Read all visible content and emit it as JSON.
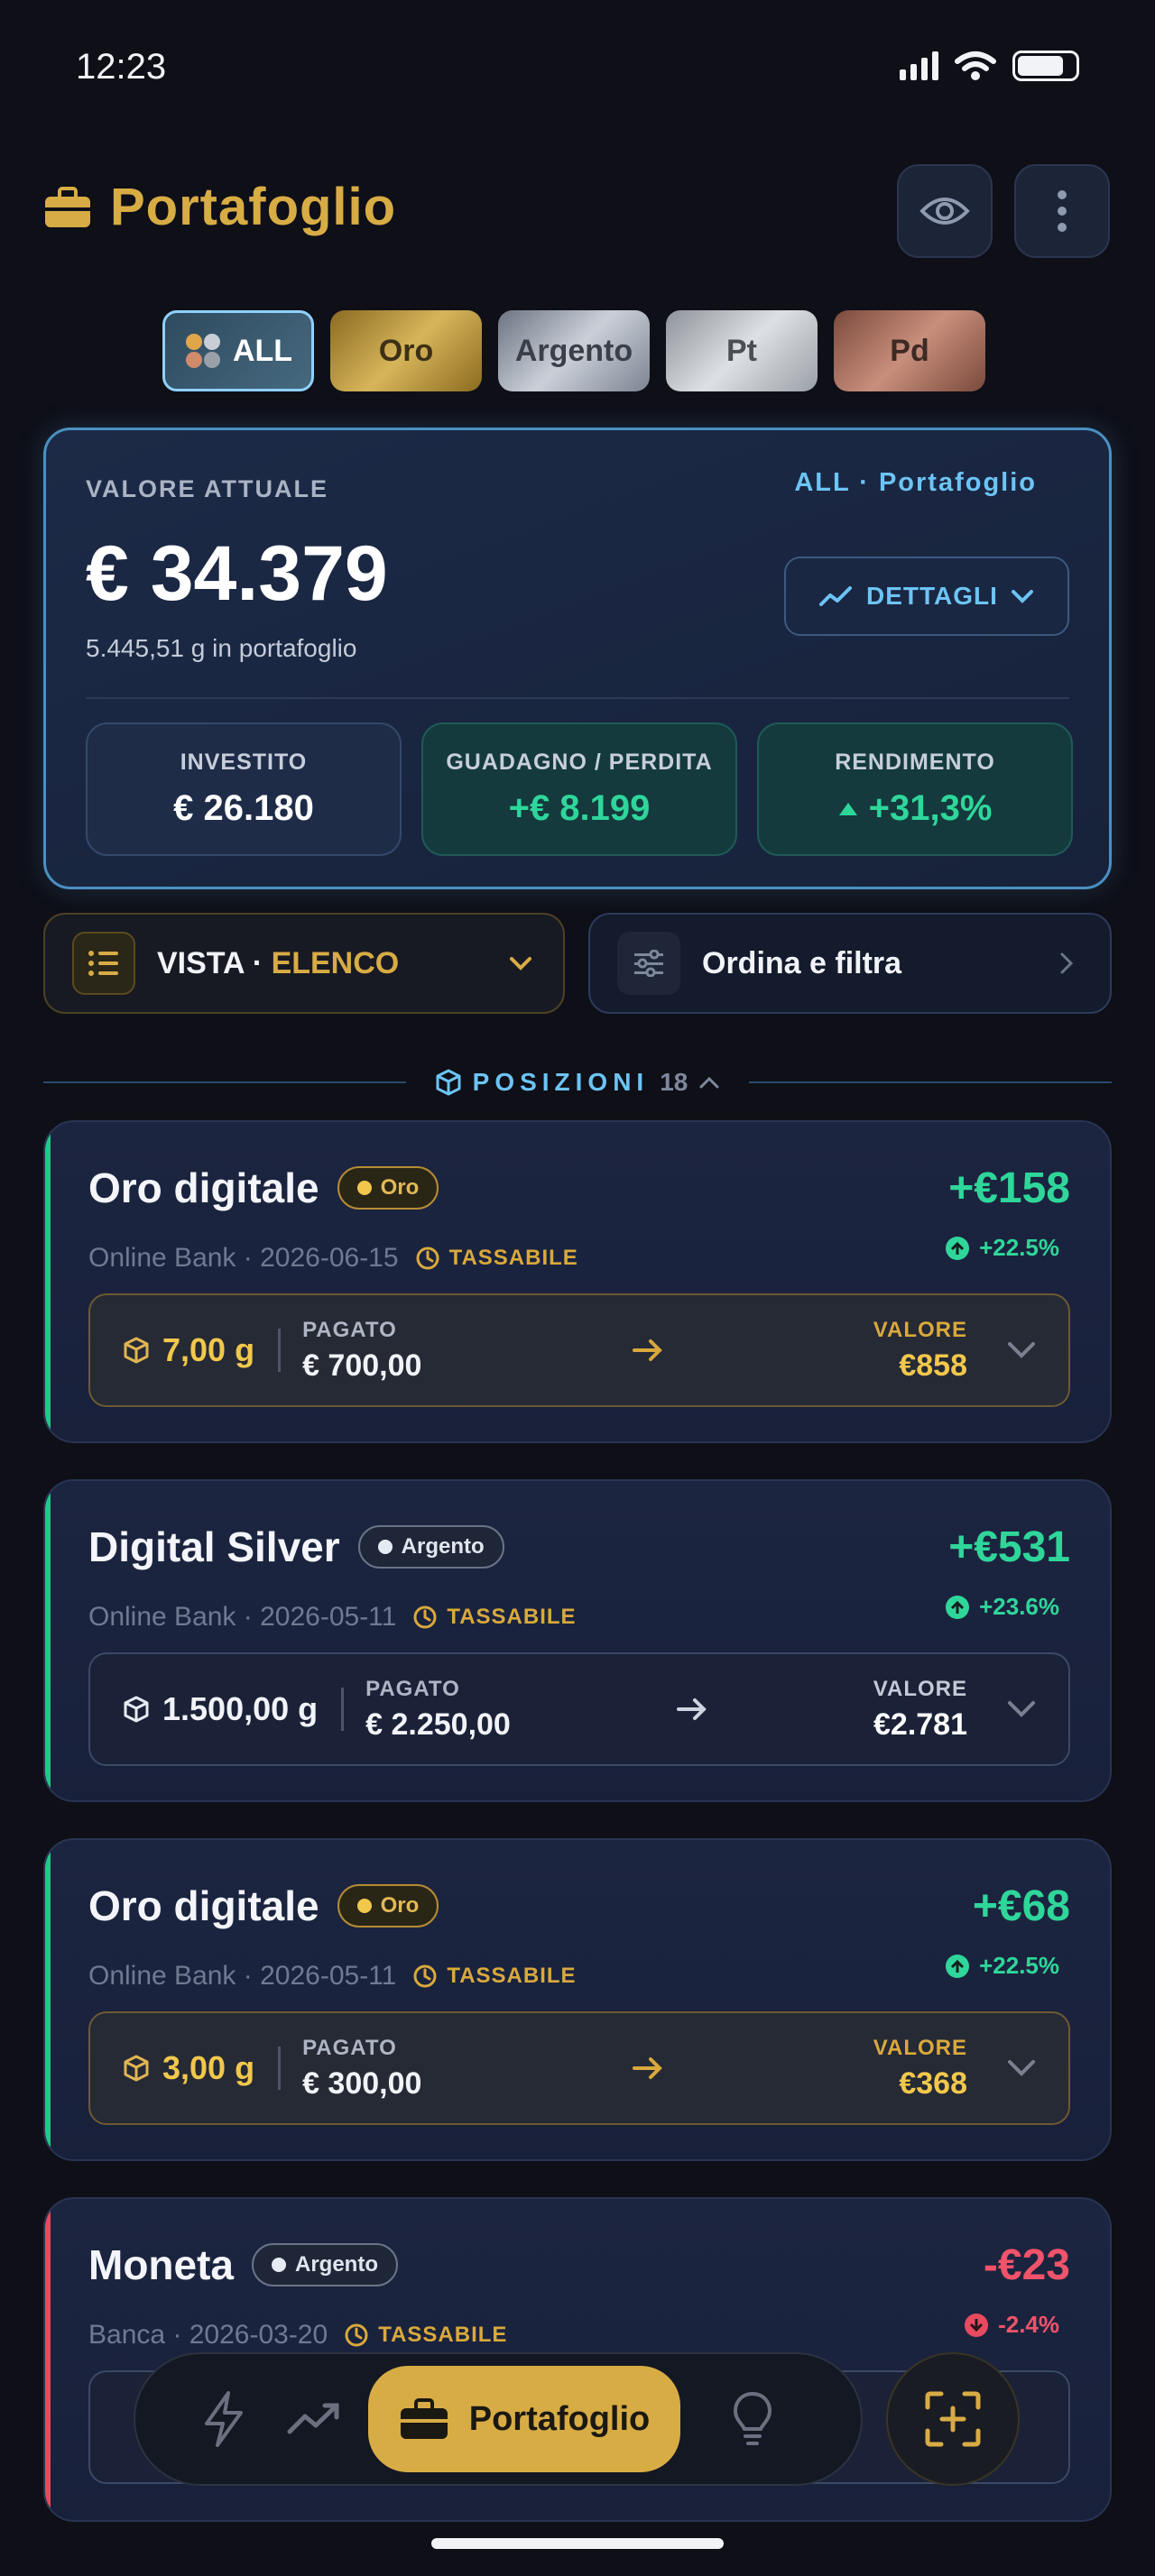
{
  "status_bar": {
    "time": "12:23"
  },
  "header": {
    "title": "Portafoglio",
    "icons": [
      "briefcase-icon",
      "eye-icon",
      "more-vertical-icon"
    ]
  },
  "chips": [
    {
      "label": "ALL"
    },
    {
      "label": "Oro"
    },
    {
      "label": "Argento"
    },
    {
      "label": "Pt"
    },
    {
      "label": "Pd"
    }
  ],
  "summary": {
    "label": "VALORE ATTUALE",
    "tag": "ALL · Portafoglio",
    "value": "€ 34.379",
    "grams": "5.445,51 g in portafoglio",
    "details_label": "DETTAGLI",
    "stats": [
      {
        "label": "INVESTITO",
        "value": "€ 26.180"
      },
      {
        "label": "GUADAGNO / PERDITA",
        "value": "+€ 8.199"
      },
      {
        "label": "RENDIMENTO",
        "value": "+31,3%"
      }
    ]
  },
  "view": {
    "prefix": "VISTA · ",
    "mode": "ELENCO"
  },
  "filter": {
    "label": "Ordina e filtra"
  },
  "positions_header": {
    "title": "POSIZIONI",
    "count": "18"
  },
  "positions": [
    {
      "name": "Oro digitale",
      "badge": "Oro",
      "meta": "Online Bank · 2026-06-15",
      "tax": "TASSABILE",
      "pl": "+€158",
      "pct": "+22.5%",
      "grams": "7,00 g",
      "paid_label": "PAGATO",
      "paid": "€ 700,00",
      "value_label": "VALORE",
      "value": "€858",
      "accent": "#1fc98a"
    },
    {
      "name": "Digital Silver",
      "badge": "Argento",
      "meta": "Online Bank · 2026-05-11",
      "tax": "TASSABILE",
      "pl": "+€531",
      "pct": "+23.6%",
      "grams": "1.500,00 g",
      "paid_label": "PAGATO",
      "paid": "€ 2.250,00",
      "value_label": "VALORE",
      "value": "€2.781",
      "accent": "#1fc98a"
    },
    {
      "name": "Oro digitale",
      "badge": "Oro",
      "meta": "Online Bank · 2026-05-11",
      "tax": "TASSABILE",
      "pl": "+€68",
      "pct": "+22.5%",
      "grams": "3,00 g",
      "paid_label": "PAGATO",
      "paid": "€ 300,00",
      "value_label": "VALORE",
      "value": "€368",
      "accent": "#1fc98a"
    },
    {
      "name": "Moneta",
      "badge": "Argento",
      "meta": "Banca · 2026-03-20",
      "tax": "TASSABILE",
      "pl": "-€23",
      "pct": "-2.4%",
      "accent": "#e84a5f"
    }
  ],
  "nav": {
    "active_label": "Portafoglio",
    "items": [
      "bolt-icon",
      "trend-icon",
      "briefcase-icon",
      "lightbulb-icon"
    ],
    "scan": "scan-add-icon"
  },
  "colors": {
    "gold": "#d8ac45",
    "accent_blue": "#6cc4f5",
    "green": "#2fd69a",
    "red": "#e84a5f",
    "background": "#0e0f17"
  }
}
